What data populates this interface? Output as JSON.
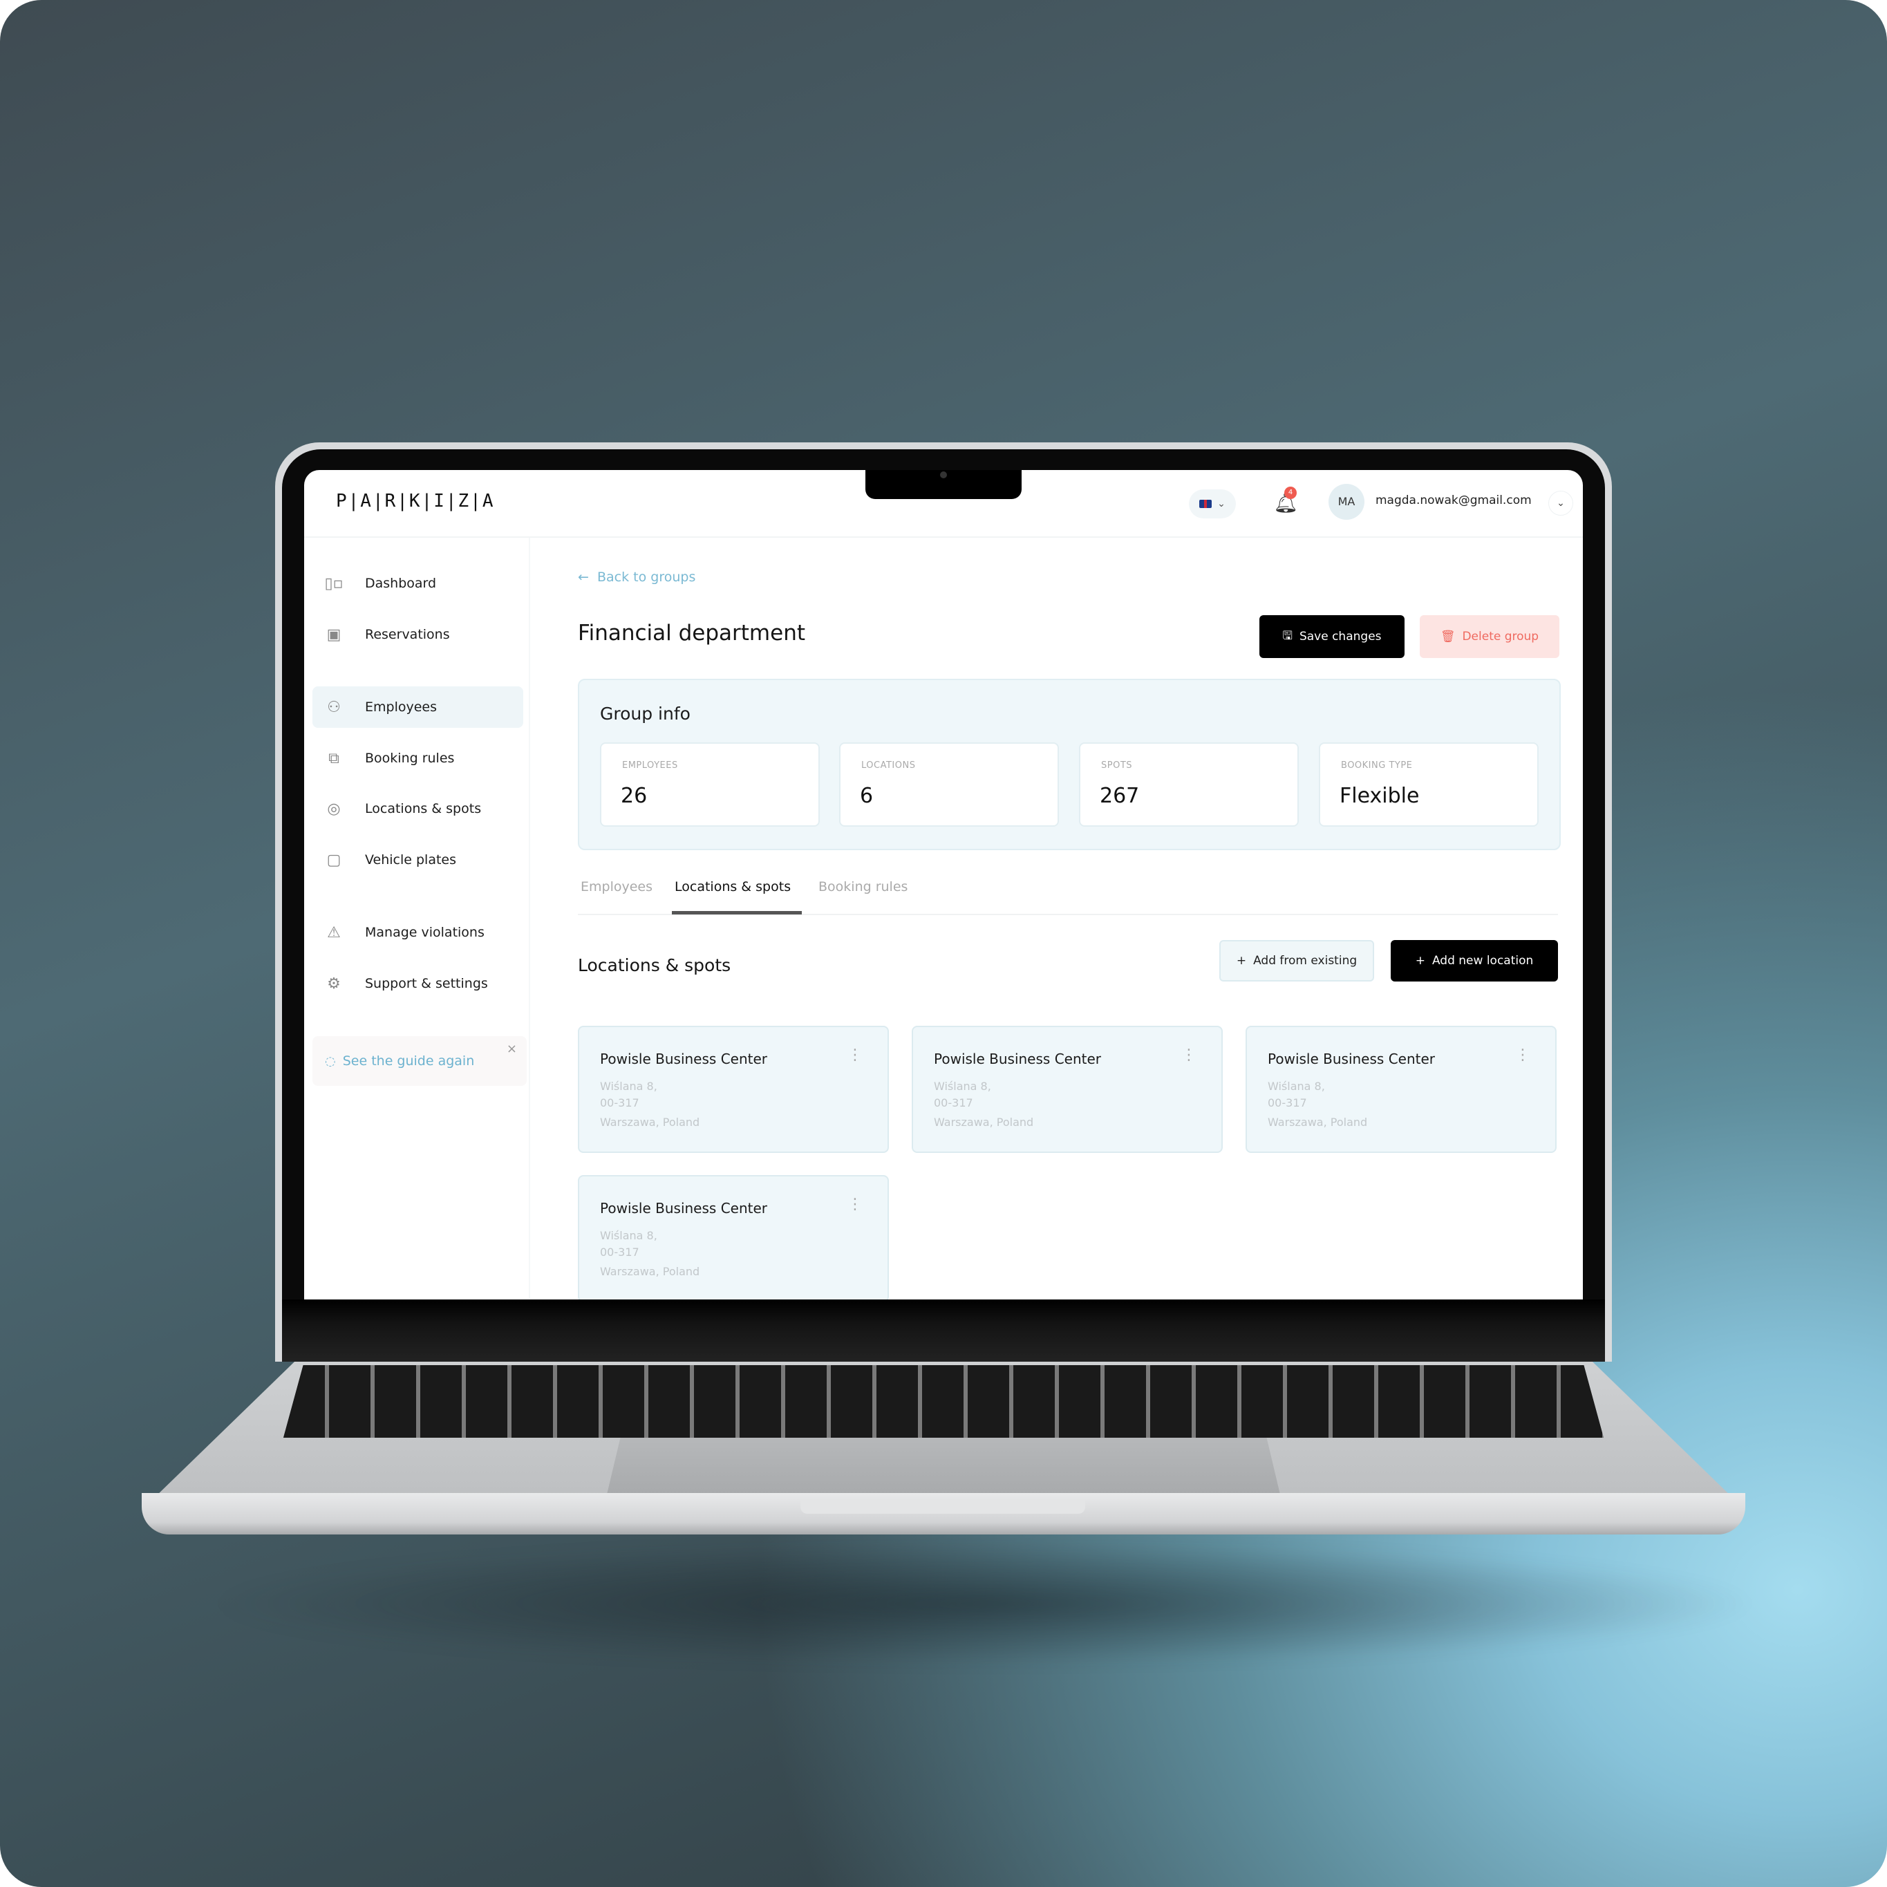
{
  "app": {
    "logo": "P|A|R|K|I|Z|A",
    "language": {
      "icon": "uk-flag-icon",
      "chevron": "⌄"
    },
    "notifications": {
      "icon": "bell-icon",
      "count": "4",
      "badge_color": "#ef5b50"
    },
    "user": {
      "initials": "MA",
      "email": "magda.nowak@gmail.com"
    }
  },
  "sidebar": {
    "items": [
      {
        "label": "Dashboard",
        "icon": "dashboard-icon",
        "glyph": "▯▫",
        "active": false
      },
      {
        "label": "Reservations",
        "icon": "calendar-check-icon",
        "glyph": "▣",
        "active": false
      },
      {
        "label": "Employees",
        "icon": "users-icon",
        "glyph": "⚇",
        "active": true
      },
      {
        "label": "Booking rules",
        "icon": "booking-rules-icon",
        "glyph": "⧉",
        "active": false
      },
      {
        "label": "Locations & spots",
        "icon": "location-pin-icon",
        "glyph": "◎",
        "active": false
      },
      {
        "label": "Vehicle plates",
        "icon": "vehicle-plate-icon",
        "glyph": "▢",
        "active": false
      },
      {
        "label": "Manage violations",
        "icon": "warning-icon",
        "glyph": "⚠",
        "active": false
      },
      {
        "label": "Support & settings",
        "icon": "gear-icon",
        "glyph": "⚙",
        "active": false
      }
    ],
    "guide": {
      "label": "See the guide again",
      "icon": "chat-icon",
      "close": "×"
    }
  },
  "page": {
    "back_link": "Back to groups",
    "title": "Financial department",
    "save_label": "Save changes",
    "delete_label": "Delete group",
    "group_info": {
      "title": "Group info",
      "stats": [
        {
          "label": "EMPLOYEES",
          "value": "26"
        },
        {
          "label": "LOCATIONS",
          "value": "6"
        },
        {
          "label": "SPOTS",
          "value": "267"
        },
        {
          "label": "BOOKING TYPE",
          "value": "Flexible"
        }
      ]
    },
    "tabs": [
      {
        "label": "Employees",
        "active": false
      },
      {
        "label": "Locations & spots",
        "active": true
      },
      {
        "label": "Booking rules",
        "active": false
      }
    ],
    "section": {
      "title": "Locations & spots",
      "add_existing_label": "Add from existing",
      "add_new_label": "Add new location"
    },
    "locations": [
      {
        "name": "Powisle Business Center",
        "street": "Wiślana 8,",
        "postcode": "00-317",
        "city": "Warszawa, Poland"
      },
      {
        "name": "Powisle Business Center",
        "street": "Wiślana 8,",
        "postcode": "00-317",
        "city": "Warszawa, Poland"
      },
      {
        "name": "Powisle Business Center",
        "street": "Wiślana 8,",
        "postcode": "00-317",
        "city": "Warszawa, Poland"
      },
      {
        "name": "Powisle Business Center",
        "street": "Wiślana 8,",
        "postcode": "00-317",
        "city": "Warszawa, Poland"
      }
    ]
  }
}
